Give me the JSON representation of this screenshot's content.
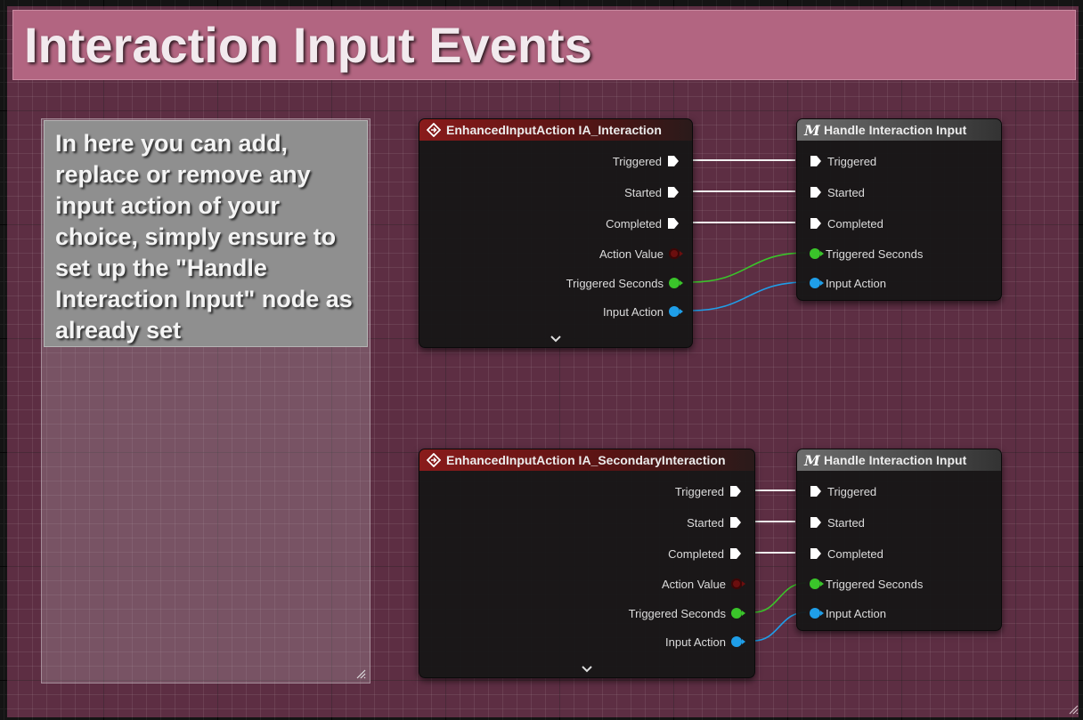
{
  "comment": {
    "title": "Interaction Input Events"
  },
  "note": {
    "text": "In here you can add, replace or remove any input action of your choice, simply ensure to set up the \"Handle Interaction Input\" node as already set"
  },
  "colors": {
    "comment_header": "#b26581",
    "exec": "#ffffff",
    "float_pin": "#3ac42a",
    "object_pin": "#1f9ee8",
    "struct_pin_action_value": "#6b0e0e"
  },
  "nodes": {
    "event_interaction": {
      "title": "EnhancedInputAction IA_Interaction",
      "icon": "event-diamond-icon",
      "pins": [
        "Triggered",
        "Started",
        "Completed",
        "Action Value",
        "Triggered Seconds",
        "Input Action"
      ]
    },
    "handle_1": {
      "title": "Handle Interaction Input",
      "icon": "macro-m-icon",
      "pins": [
        "Triggered",
        "Started",
        "Completed",
        "Triggered Seconds",
        "Input Action"
      ]
    },
    "event_secondary": {
      "title": "EnhancedInputAction IA_SecondaryInteraction",
      "icon": "event-diamond-icon",
      "pins": [
        "Triggered",
        "Started",
        "Completed",
        "Action Value",
        "Triggered Seconds",
        "Input Action"
      ]
    },
    "handle_2": {
      "title": "Handle Interaction Input",
      "icon": "macro-m-icon",
      "pins": [
        "Triggered",
        "Started",
        "Completed",
        "Triggered Seconds",
        "Input Action"
      ]
    }
  }
}
